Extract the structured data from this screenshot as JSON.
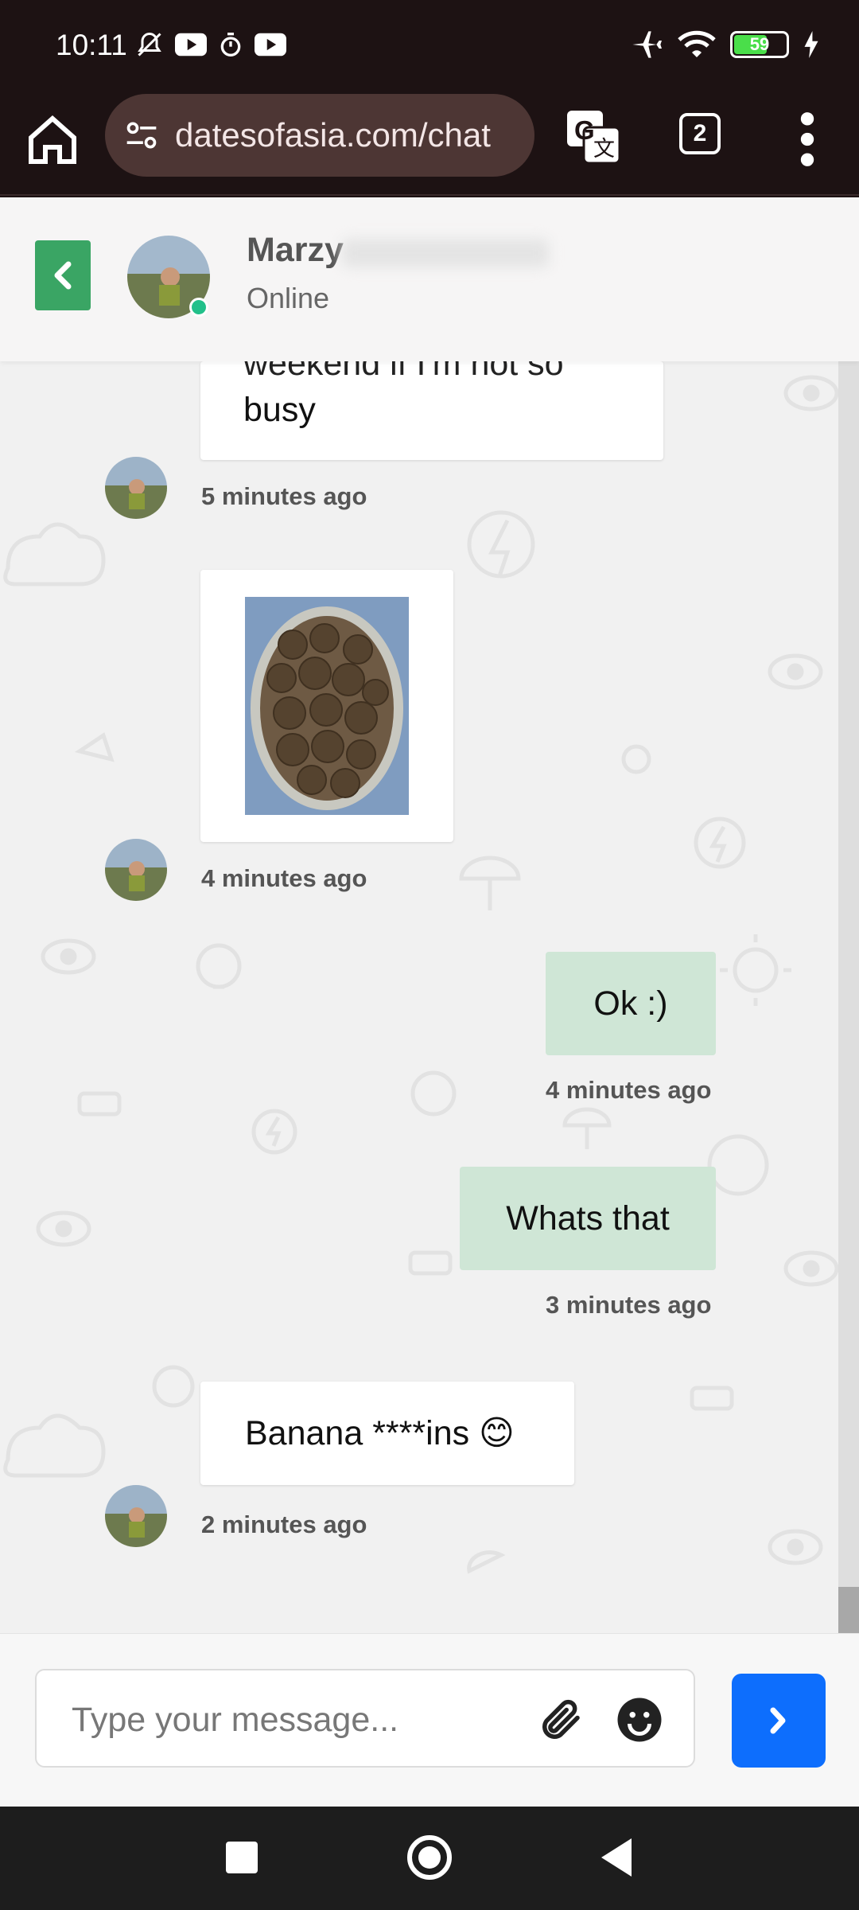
{
  "status_bar": {
    "time": "10:11",
    "battery": "59",
    "icons_left": [
      "bell-muted-icon",
      "youtube-icon",
      "stopwatch-icon",
      "youtube-icon"
    ],
    "icons_right": [
      "airplane-icon",
      "wifi-icon",
      "battery-icon",
      "charging-icon"
    ]
  },
  "browser": {
    "url": "datesofasia.com/chat",
    "tab_count": "2"
  },
  "chat_header": {
    "name": "Marzy",
    "status": "Online"
  },
  "messages": [
    {
      "direction": "in",
      "text_partial": "weekend if I'm not so",
      "text": "busy",
      "time": "5 minutes ago"
    },
    {
      "direction": "in",
      "type": "image",
      "time": "4 minutes ago"
    },
    {
      "direction": "out",
      "text": "Ok :)",
      "time": "4 minutes ago"
    },
    {
      "direction": "out",
      "text": "Whats that",
      "time": "3 minutes ago"
    },
    {
      "direction": "in",
      "text": "Banana ****ins 😊",
      "time": "2 minutes ago"
    }
  ],
  "input": {
    "placeholder": "Type your message..."
  },
  "colors": {
    "accent_send": "#0d6efd",
    "back_button": "#3aa564",
    "outgoing_bubble": "#cfe6d6",
    "online_dot": "#22c08a"
  }
}
